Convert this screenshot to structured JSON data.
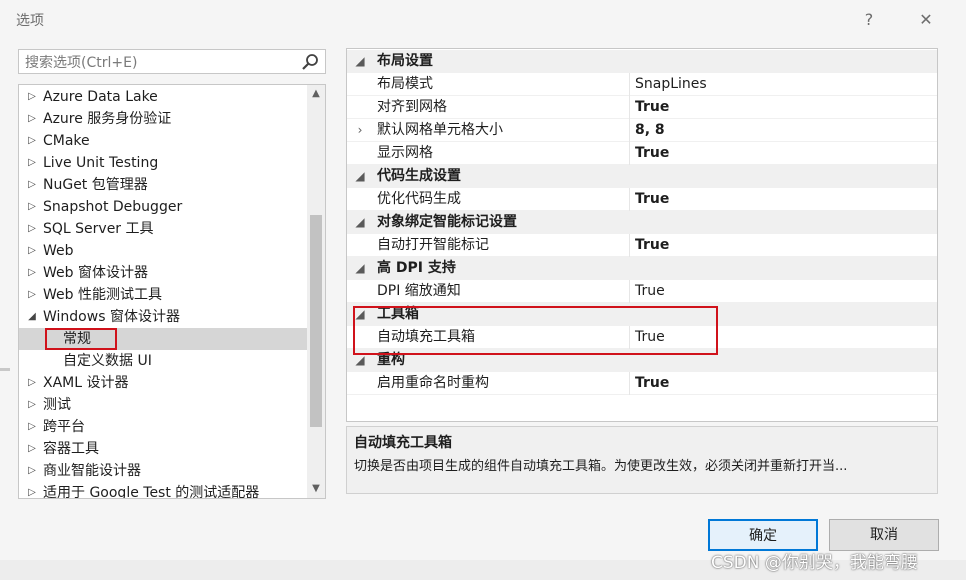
{
  "window": {
    "title": "选项",
    "help_glyph": "?",
    "close_glyph": "✕"
  },
  "search": {
    "placeholder": "搜索选项(Ctrl+E)"
  },
  "tree": {
    "items": [
      {
        "label": "Azure Data Lake",
        "level": 0,
        "arrow": "▷"
      },
      {
        "label": "Azure 服务身份验证",
        "level": 0,
        "arrow": "▷"
      },
      {
        "label": "CMake",
        "level": 0,
        "arrow": "▷"
      },
      {
        "label": "Live Unit Testing",
        "level": 0,
        "arrow": "▷"
      },
      {
        "label": "NuGet 包管理器",
        "level": 0,
        "arrow": "▷"
      },
      {
        "label": "Snapshot Debugger",
        "level": 0,
        "arrow": "▷"
      },
      {
        "label": "SQL Server 工具",
        "level": 0,
        "arrow": "▷"
      },
      {
        "label": "Web",
        "level": 0,
        "arrow": "▷"
      },
      {
        "label": "Web 窗体设计器",
        "level": 0,
        "arrow": "▷"
      },
      {
        "label": "Web 性能测试工具",
        "level": 0,
        "arrow": "▷"
      },
      {
        "label": "Windows 窗体设计器",
        "level": 0,
        "arrow": "◢"
      },
      {
        "label": "常规",
        "level": 1,
        "arrow": ""
      },
      {
        "label": "自定义数据 UI",
        "level": 1,
        "arrow": ""
      },
      {
        "label": "XAML 设计器",
        "level": 0,
        "arrow": "▷"
      },
      {
        "label": "测试",
        "level": 0,
        "arrow": "▷"
      },
      {
        "label": "跨平台",
        "level": 0,
        "arrow": "▷"
      },
      {
        "label": "容器工具",
        "level": 0,
        "arrow": "▷"
      },
      {
        "label": "商业智能设计器",
        "level": 0,
        "arrow": "▷"
      },
      {
        "label": "适用于 Google Test 的测试适配器",
        "level": 0,
        "arrow": "▷"
      }
    ],
    "selected_index": 11
  },
  "grid": {
    "rows": [
      {
        "kind": "cat",
        "name": "布局设置",
        "exp": "◢"
      },
      {
        "kind": "item",
        "name": "布局模式",
        "value": "SnapLines",
        "bold": false
      },
      {
        "kind": "item",
        "name": "对齐到网格",
        "value": "True",
        "bold": true
      },
      {
        "kind": "item",
        "name": "默认网格单元格大小",
        "value": "8, 8",
        "bold": true,
        "exp": "›"
      },
      {
        "kind": "item",
        "name": "显示网格",
        "value": "True",
        "bold": true
      },
      {
        "kind": "cat",
        "name": "代码生成设置",
        "exp": "◢"
      },
      {
        "kind": "item",
        "name": "优化代码生成",
        "value": "True",
        "bold": true
      },
      {
        "kind": "cat",
        "name": "对象绑定智能标记设置",
        "exp": "◢"
      },
      {
        "kind": "item",
        "name": "自动打开智能标记",
        "value": "True",
        "bold": true
      },
      {
        "kind": "cat",
        "name": "高 DPI 支持",
        "exp": "◢"
      },
      {
        "kind": "item",
        "name": "DPI 缩放通知",
        "value": "True",
        "bold": false
      },
      {
        "kind": "cat",
        "name": "工具箱",
        "exp": "◢"
      },
      {
        "kind": "item",
        "name": "自动填充工具箱",
        "value": "True",
        "bold": false
      },
      {
        "kind": "cat",
        "name": "重构",
        "exp": "◢"
      },
      {
        "kind": "item",
        "name": "启用重命名时重构",
        "value": "True",
        "bold": true
      }
    ]
  },
  "description": {
    "title": "自动填充工具箱",
    "text": "切换是否由项目生成的组件自动填充工具箱。为使更改生效，必须关闭并重新打开当..."
  },
  "buttons": {
    "ok": "确定",
    "cancel": "取消"
  },
  "watermark": "CSDN @你别哭，我能弯腰",
  "colors": {
    "accent": "#0078d7",
    "highlight_box": "#d0121b",
    "selection": "#d6d6d6"
  }
}
